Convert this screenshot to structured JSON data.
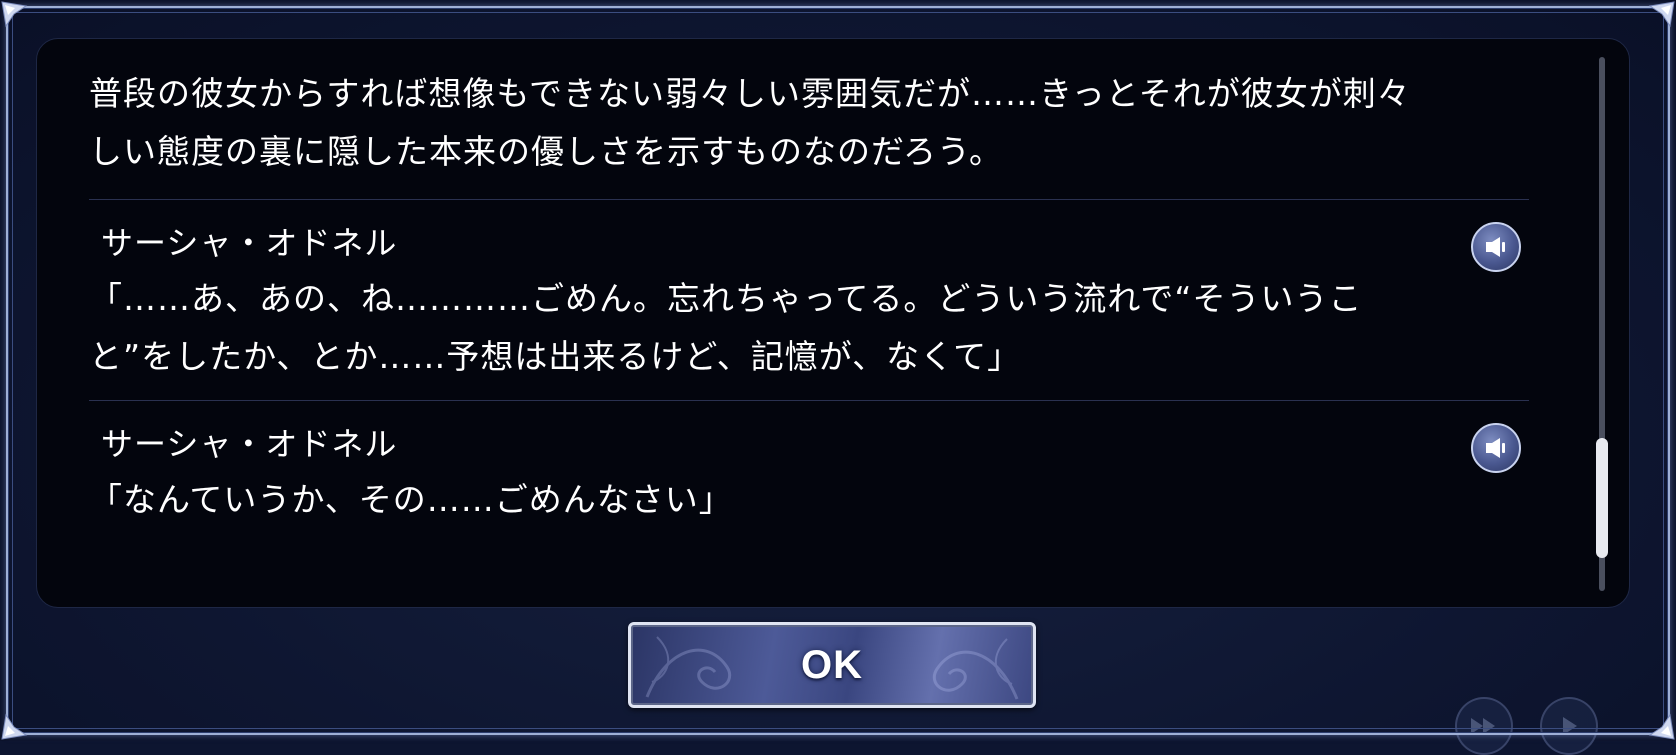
{
  "log": {
    "narration_lines": [
      "普段の彼女からすれば想像もできない弱々しい雰囲気だが……きっとそれが彼女が刺々",
      "しい態度の裏に隠した本来の優しさを示すものなのだろう。"
    ],
    "entries": [
      {
        "speaker": "サーシャ・オドネル",
        "lines": [
          "「……あ、あの、ね…………ごめん。忘れちゃってる。どういう流れで“そういうこ",
          "と”をしたか、とか……予想は出来るけど、記憶が、なくて」"
        ]
      },
      {
        "speaker": "サーシャ・オドネル",
        "lines": [
          "「なんていうか、その……ごめんなさい」"
        ]
      }
    ],
    "voice_icon": "speaker-icon",
    "scroll_position": 0.92
  },
  "ok_button": {
    "label": "OK"
  },
  "background_buttons": {
    "icons": [
      "fast-forward-icon",
      "play-icon"
    ]
  },
  "colors": {
    "panel_bg": "#03050d",
    "frame_border": "#9fb0d6",
    "button_accent": "#4d5a98"
  }
}
